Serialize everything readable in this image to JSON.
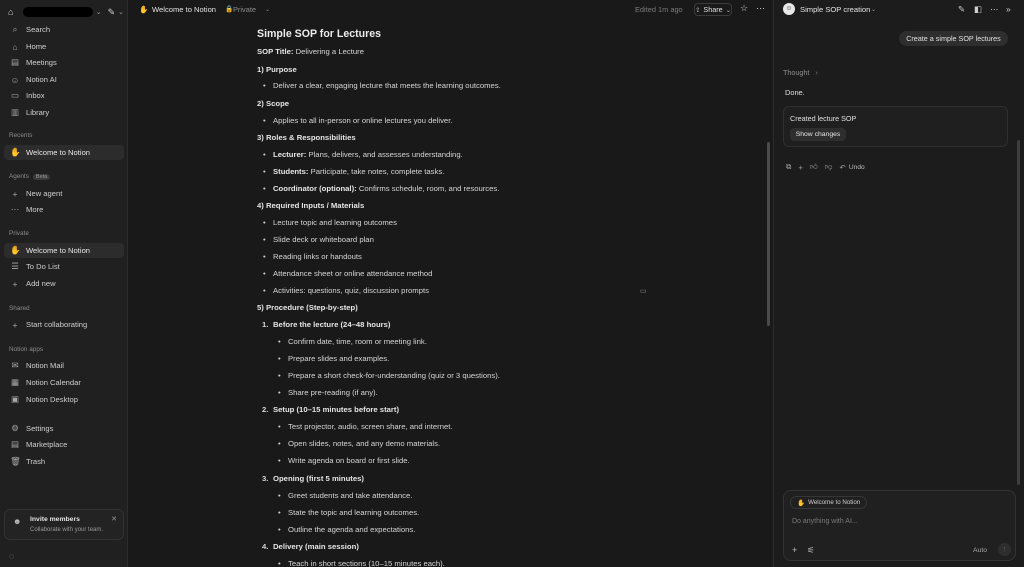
{
  "sidebar": {
    "workspace_edit_icon": "pencil-square-icon",
    "nav": [
      {
        "label": "Search",
        "icon": "search-icon"
      },
      {
        "label": "Home",
        "icon": "home-icon"
      },
      {
        "label": "Meetings",
        "icon": "meetings-icon"
      },
      {
        "label": "Notion AI",
        "icon": "notion-ai-icon"
      },
      {
        "label": "Inbox",
        "icon": "inbox-icon"
      },
      {
        "label": "Library",
        "icon": "library-icon"
      }
    ],
    "recents_label": "Recents",
    "recents": [
      {
        "label": "Welcome to Notion",
        "icon": "waving-hand-icon"
      }
    ],
    "agents_label": "Agents",
    "agents_badge": "Beta",
    "agents": [
      {
        "label": "New agent",
        "icon": "plus-icon"
      },
      {
        "label": "More",
        "icon": "more-icon"
      }
    ],
    "private_label": "Private",
    "private": [
      {
        "label": "Welcome to Notion",
        "icon": "waving-hand-icon"
      },
      {
        "label": "To Do List",
        "icon": "checklist-icon"
      },
      {
        "label": "Add new",
        "icon": "plus-icon"
      }
    ],
    "shared_label": "Shared",
    "shared": [
      {
        "label": "Start collaborating",
        "icon": "plus-icon"
      }
    ],
    "apps_label": "Notion apps",
    "apps": [
      {
        "label": "Notion Mail",
        "icon": "mail-icon"
      },
      {
        "label": "Notion Calendar",
        "icon": "calendar-icon"
      },
      {
        "label": "Notion Desktop",
        "icon": "desktop-icon"
      }
    ],
    "bottom": [
      {
        "label": "Settings",
        "icon": "gear-icon"
      },
      {
        "label": "Marketplace",
        "icon": "marketplace-icon"
      },
      {
        "label": "Trash",
        "icon": "trash-icon"
      }
    ],
    "invite": {
      "title": "Invite members",
      "subtitle": "Collaborate with your team."
    }
  },
  "topbar": {
    "page_title": "Welcome to Notion",
    "visibility": "Private",
    "edited": "Edited 1m ago",
    "share": "Share"
  },
  "document": {
    "title": "Simple SOP for Lectures",
    "sop_title_label": "SOP Title:",
    "sop_title_value": " Delivering a Lecture",
    "s1": "1) Purpose",
    "s1_b1": "Deliver a clear, engaging lecture that meets the learning outcomes.",
    "s2": "2) Scope",
    "s2_b1": "Applies to all in-person or online lectures you deliver.",
    "s3": "3) Roles & Responsibilities",
    "s3_roles": [
      {
        "role": "Lecturer:",
        "desc": " Plans, delivers, and assesses understanding."
      },
      {
        "role": "Students:",
        "desc": " Participate, take notes, complete tasks."
      },
      {
        "role": "Coordinator (optional):",
        "desc": " Confirms schedule, room, and resources."
      }
    ],
    "s4": "4) Required Inputs / Materials",
    "s4_items": [
      "Lecture topic and learning outcomes",
      "Slide deck or whiteboard plan",
      "Reading links or handouts",
      "Attendance sheet or online attendance method",
      "Activities: questions, quiz, discussion prompts"
    ],
    "s5": "5) Procedure (Step-by-step)",
    "steps": [
      {
        "num": "1.",
        "title": "Before the lecture (24–48 hours)",
        "items": [
          "Confirm date, time, room or meeting link.",
          "Prepare slides and examples.",
          "Prepare a short check-for-understanding (quiz or 3 questions).",
          "Share pre-reading (if any)."
        ]
      },
      {
        "num": "2.",
        "title": "Setup (10–15 minutes before start)",
        "items": [
          "Test projector, audio, screen share, and internet.",
          "Open slides, notes, and any demo materials.",
          "Write agenda on board or first slide."
        ]
      },
      {
        "num": "3.",
        "title": "Opening (first 5 minutes)",
        "items": [
          "Greet students and take attendance.",
          "State the topic and learning outcomes.",
          "Outline the agenda and expectations."
        ]
      },
      {
        "num": "4.",
        "title": "Delivery (main session)",
        "items": [
          "Teach in short sections (10–15 minutes each)."
        ]
      }
    ]
  },
  "ai_panel": {
    "title": "Simple SOP creation",
    "user_message": "Create a simple SOP lectures",
    "thought_label": "Thought",
    "done_text": "Done.",
    "card_text": "Created lecture SOP",
    "card_button": "Show changes",
    "undo_label": "Undo",
    "composer": {
      "context_chip": "Welcome to Notion",
      "placeholder": "Do anything with AI...",
      "mode": "Auto"
    }
  }
}
